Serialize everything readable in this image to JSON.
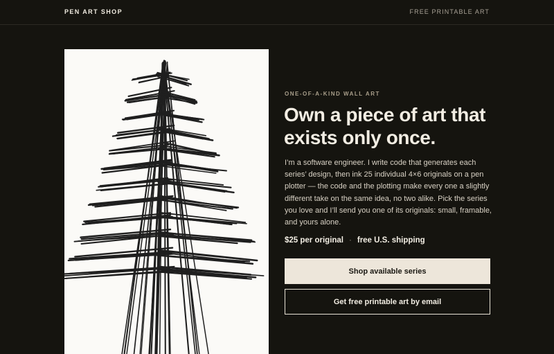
{
  "header": {
    "logo": "PEN ART SHOP",
    "nav_link": "FREE PRINTABLE ART"
  },
  "hero": {
    "image_alt": "pen plotter drawing of a tree made of black ink lines",
    "eyebrow": "ONE-OF-A-KIND WALL ART",
    "headline": "Own a piece of art that exists only once.",
    "body": "I’m a software engineer. I write code that generates each series’ design, then ink 25 individual 4×6 originals on a pen plotter — the code and the plotting make every one a slightly different take on the same idea, no two alike. Pick the series you love and I’ll send you one of its originals: small, framable, and yours alone.",
    "price": "$25 per original",
    "separator": "·",
    "shipping": "free U.S. shipping",
    "primary_button": "Shop available series",
    "secondary_button": "Get free printable art by email"
  },
  "colors": {
    "background": "#15140f",
    "ink": "#1f1f1f",
    "paper": "#fbfaf7",
    "button_fill": "#ede6da"
  }
}
